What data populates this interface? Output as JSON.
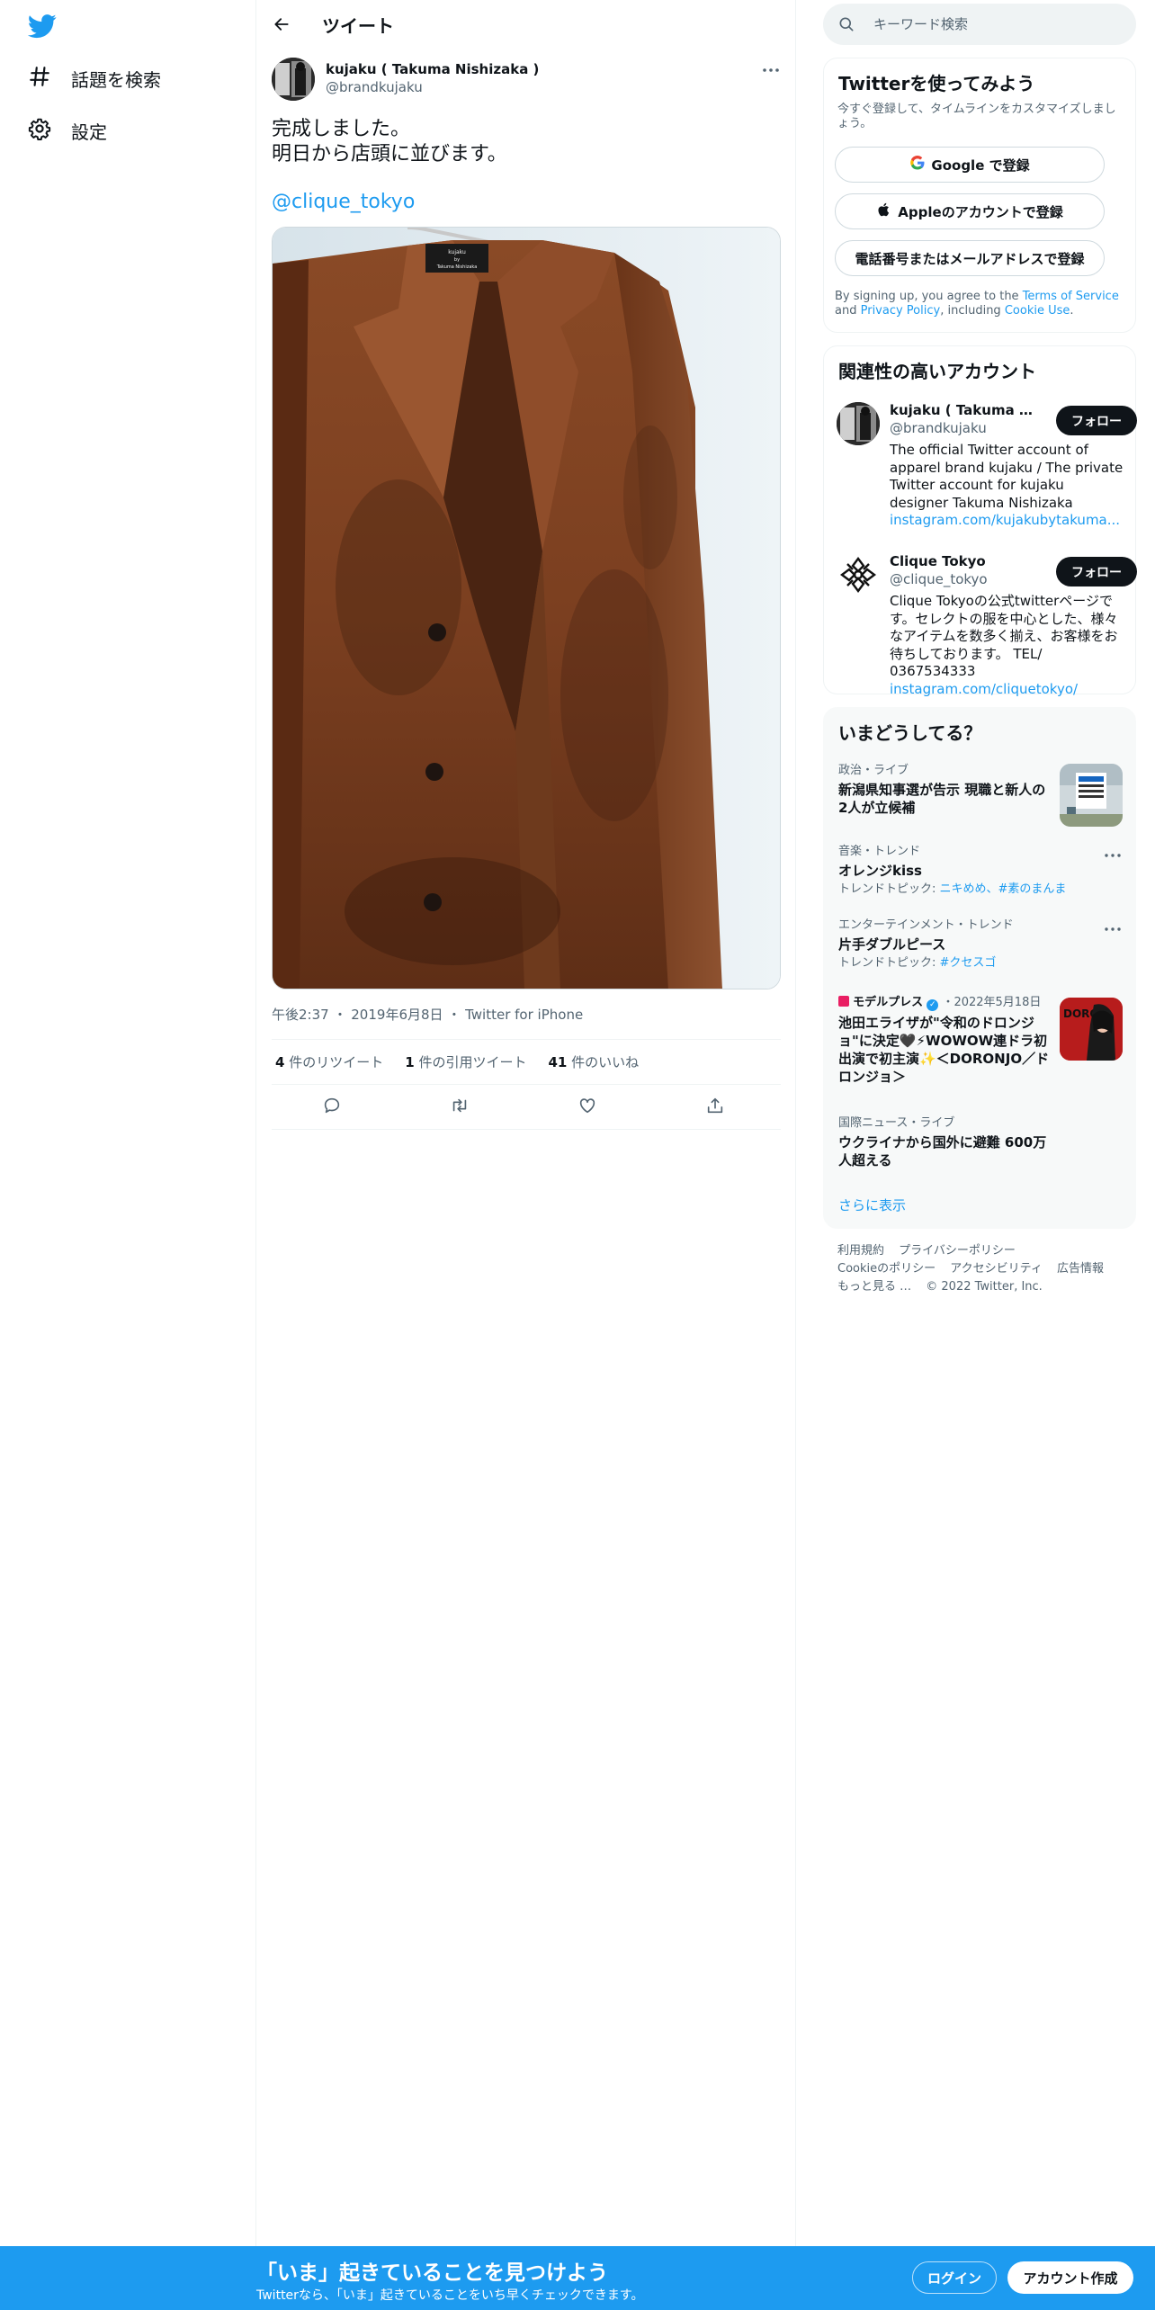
{
  "brand": {
    "accent": "#1d9bf0",
    "text": "#0f1419",
    "muted": "#536471"
  },
  "nav": {
    "logo_icon": "twitter-bird-icon",
    "items": [
      {
        "label": "話題を検索",
        "icon": "hashtag-icon"
      },
      {
        "label": "設定",
        "icon": "gear-icon"
      }
    ]
  },
  "header": {
    "title": "ツイート"
  },
  "tweet": {
    "author_name": "kujaku ( Takuma Nishizaka )",
    "author_handle": "@brandkujaku",
    "text_lines": [
      "完成しました。",
      "明日から店頭に並びます。"
    ],
    "mention": "@clique_tokyo",
    "photo_tag_lines": [
      "kujaku",
      "by",
      "Takuma Nishizaka"
    ],
    "time": "午後2:37",
    "date": "2019年6月8日",
    "source": "Twitter for iPhone",
    "stats": {
      "retweets_count": "4",
      "retweets_label": "件のリツイート",
      "quotes_count": "1",
      "quotes_label": "件の引用ツイート",
      "likes_count": "41",
      "likes_label": "件のいいね"
    }
  },
  "search": {
    "placeholder": "キーワード検索"
  },
  "signup": {
    "title": "Twitterを使ってみよう",
    "description": "今すぐ登録して、タイムラインをカスタマイズしましょう。",
    "google": "Google で登録",
    "apple": "Appleのアカウントで登録",
    "phone_email": "電話番号またはメールアドレスで登録",
    "terms_prefix": "By signing up, you agree to the",
    "terms_of_service": "Terms of Service",
    "and": "and",
    "privacy_policy": "Privacy Policy",
    "including": ", including",
    "cookie_use": "Cookie Use",
    "period": "."
  },
  "relevant": {
    "title": "関連性の高いアカウント",
    "follow_label": "フォロー",
    "accounts": [
      {
        "name": "kujaku ( Takuma Nishizaka )",
        "handle": "@brandkujaku",
        "bio": "The official Twitter account of apparel brand kujaku / The private Twitter account for kujaku designer Takuma Nishizaka",
        "link": "instagram.com/kujakubytakuma..."
      },
      {
        "name": "Clique Tokyo",
        "handle": "@clique_tokyo",
        "bio": "Clique Tokyoの公式twitterページです。セレクトの服を中心とした、様々なアイテムを数多く揃え、お客様をお待ちしております。 TEL/ 0367534333",
        "link": "instagram.com/cliquetokyo/"
      }
    ]
  },
  "trends": {
    "title": "いまどうしてる？",
    "items": [
      {
        "context": "政治・ライブ",
        "name": "新潟県知事選が告示 現職と新人の2人が立候補"
      },
      {
        "context": "音楽・トレンド",
        "name": "オレンジkiss",
        "sub_prefix": "トレンドトピック: ",
        "sub_links": "ニキめめ、#素のまんま"
      },
      {
        "context": "エンターテインメント・トレンド",
        "name": "片手ダブルピース",
        "sub_prefix": "トレンドトピック: ",
        "sub_links": "#クセスゴ"
      },
      {
        "source": "モデルプレス",
        "date": "・2022年5月18日",
        "name": "池田エライザが\"令和のドロンジョ\"に決定🖤⚡WOWOW連ドラ初出演で初主演✨＜DORONJO／ドロンジョ＞"
      },
      {
        "context": "国際ニュース・ライブ",
        "name": "ウクライナから国外に避難 600万人超える"
      }
    ],
    "show_more": "さらに表示"
  },
  "footer": {
    "terms": "利用規約",
    "privacy": "プライバシーポリシー",
    "cookie": "Cookieのポリシー",
    "accessibility": "アクセシビリティ",
    "ads": "広告情報",
    "more": "もっと見る …",
    "copyright": "© 2022 Twitter, Inc."
  },
  "banner": {
    "title": "「いま」起きていることを見つけよう",
    "subtitle": "Twitterなら、「いま」起きていることをいち早くチェックできます。",
    "login": "ログイン",
    "signup": "アカウント作成"
  }
}
